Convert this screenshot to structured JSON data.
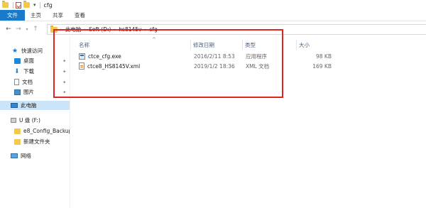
{
  "window": {
    "title": "cfg"
  },
  "quick_access_toolbar": {
    "dropdown_glyph": "▾"
  },
  "ribbon": {
    "tabs": [
      {
        "label": "文件"
      },
      {
        "label": "主页"
      },
      {
        "label": "共享"
      },
      {
        "label": "查看"
      }
    ]
  },
  "address_bar": {
    "breadcrumbs": [
      "此电脑",
      "Soft (D:)",
      "hs8145v",
      "cfg"
    ],
    "separator": "›"
  },
  "sidebar": {
    "items": [
      {
        "label": "快速访问",
        "icon": "star-icon",
        "pinned": false
      },
      {
        "label": "桌面",
        "icon": "desktop-icon",
        "pinned": true
      },
      {
        "label": "下载",
        "icon": "download-icon",
        "pinned": true
      },
      {
        "label": "文档",
        "icon": "document-icon",
        "pinned": true
      },
      {
        "label": "图片",
        "icon": "pictures-icon",
        "pinned": true
      },
      {
        "label": "此电脑",
        "icon": "computer-icon",
        "pinned": false
      },
      {
        "label": "U 盘 (F:)",
        "icon": "usb-drive-icon",
        "pinned": false
      },
      {
        "label": "e8_Config_Backup",
        "icon": "folder-icon",
        "pinned": false
      },
      {
        "label": "新建文件夹",
        "icon": "folder-icon",
        "pinned": false
      },
      {
        "label": "网络",
        "icon": "network-icon",
        "pinned": false
      }
    ],
    "pin_glyph": "✦"
  },
  "file_list": {
    "columns": {
      "name": "名称",
      "date": "修改日期",
      "type": "类型",
      "size": "大小"
    },
    "sort_glyph": "^",
    "files": [
      {
        "name": "ctce_cfg.exe",
        "date": "2016/2/11 8:53",
        "type": "应用程序",
        "size": "98 KB",
        "icon": "exe-icon"
      },
      {
        "name": "ctce8_HS8145V.xml",
        "date": "2019/1/2 18:36",
        "type": "XML 文档",
        "size": "169 KB",
        "icon": "xml-icon"
      }
    ]
  },
  "colors": {
    "accent": "#1979ca",
    "selection": "#cce4f7",
    "annotation_red": "#e02424"
  }
}
